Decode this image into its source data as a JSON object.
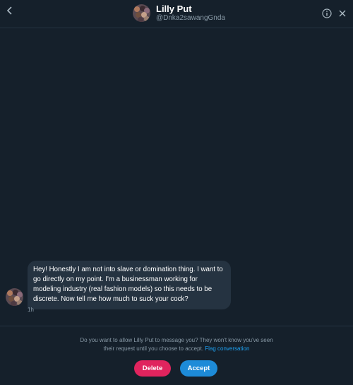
{
  "header": {
    "name": "Lilly Put",
    "handle": "@Dnka2sawangGnda"
  },
  "icons": {
    "back": "chevron-left-icon",
    "info": "info-circle-icon",
    "close": "close-icon",
    "avatar": "avatar-image"
  },
  "message": {
    "text": "Hey! Honestly I am not into slave or domination thing. I want to go directly on my point. I'm a businessman working for modeling industry (real fashion models) so this needs to be discrete. Now tell me how much to suck your cock?",
    "time": "1h"
  },
  "request": {
    "text": "Do you want to allow Lilly Put to message you? They won't know you've seen their request until you choose to accept.",
    "flag_label": "Flag conversation"
  },
  "actions": {
    "delete_label": "Delete",
    "accept_label": "Accept"
  },
  "colors": {
    "background": "#15202b",
    "bubble": "#253341",
    "secondary_text": "#8899a6",
    "link": "#1da1f2",
    "delete": "#e0245e",
    "accept": "#1d8bd8"
  }
}
